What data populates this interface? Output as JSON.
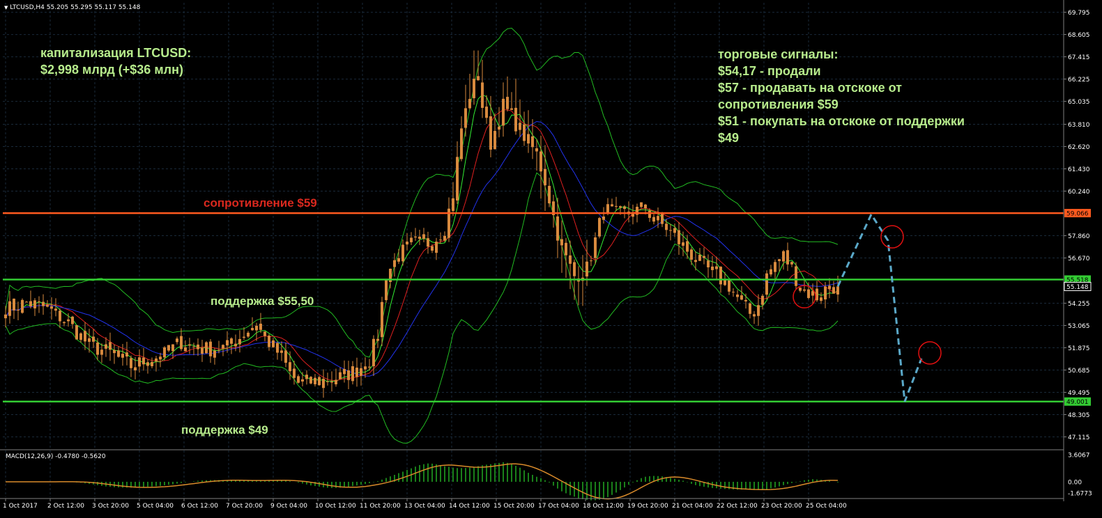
{
  "header": {
    "title": "LTCUSD,H4",
    "ohlc": "55.205 55.295 55.117 55.148"
  },
  "macd": {
    "label": "MACD(12,26,9) -0.4780 -0.5620",
    "ticks": [
      "3.6067",
      "0.00",
      "-1.6773"
    ]
  },
  "notes": {
    "cap_line1": "капитализация LTCUSD:",
    "cap_line2": "$2,998 млрд (+$36 млн)",
    "signals": [
      "торговые сигналы:",
      "$54,17 - продали",
      "$57 - продавать на отскоке от",
      "сопротивления $59",
      "$51 - покупать на отскоке от поддержки",
      "$49"
    ],
    "resistance_label": "сопротивление $59",
    "support1_label": "поддержка $55,50",
    "support2_label": "поддержка $49"
  },
  "colors": {
    "background": "#000000",
    "grid": "#1a2a3a",
    "axis": "#7f7f7f",
    "bull_candle": "#d88a3e",
    "bear_candle": "#d88a3e",
    "resistance": "#ff5a1f",
    "support": "#33cc33",
    "bollinger": "#22bb22",
    "ma_fast": "#33ee33",
    "ma_mid": "#e02020",
    "ma_slow": "#2233ee",
    "forecast": "#5aa8c8",
    "circle": "#e01010",
    "macd_hist": "#22aa22",
    "macd_signal": "#d98a2a",
    "text_note": "#b7ec8c",
    "text_red": "#d9281e"
  },
  "chart_data": {
    "type": "candlestick",
    "timeframe": "H4",
    "ylim": [
      46.5,
      70.3
    ],
    "y_ticks": [
      "69.795",
      "68.605",
      "67.415",
      "66.225",
      "65.035",
      "63.810",
      "62.620",
      "61.430",
      "60.240",
      "59.066",
      "57.860",
      "56.670",
      "55.518",
      "55.148",
      "54.255",
      "53.065",
      "51.875",
      "50.685",
      "49.495",
      "49.001",
      "48.305",
      "47.115"
    ],
    "x_ticks": [
      "1 Oct 2017",
      "2 Oct 12:00",
      "3 Oct 20:00",
      "5 Oct 04:00",
      "6 Oct 12:00",
      "7 Oct 20:00",
      "9 Oct 04:00",
      "10 Oct 12:00",
      "11 Oct 20:00",
      "13 Oct 04:00",
      "14 Oct 12:00",
      "15 Oct 20:00",
      "17 Oct 04:00",
      "18 Oct 12:00",
      "19 Oct 20:00",
      "21 Oct 04:00",
      "22 Oct 12:00",
      "23 Oct 20:00",
      "25 Oct 04:00"
    ],
    "levels": [
      {
        "name": "resistance",
        "value": 59.066,
        "tag": "59.066"
      },
      {
        "name": "support",
        "value": 55.518,
        "tag": "55.518"
      },
      {
        "name": "support",
        "value": 49.001,
        "tag": "49.001"
      }
    ],
    "current_price": {
      "value": 55.148,
      "tag": "55.148"
    },
    "price_anchors": [
      [
        0,
        53.9
      ],
      [
        5,
        54.3
      ],
      [
        10,
        54.0
      ],
      [
        15,
        53.2
      ],
      [
        20,
        52.0
      ],
      [
        25,
        51.6
      ],
      [
        30,
        50.9
      ],
      [
        35,
        51.3
      ],
      [
        38,
        51.5
      ],
      [
        42,
        52.2
      ],
      [
        45,
        51.9
      ],
      [
        48,
        51.8
      ],
      [
        53,
        51.9
      ],
      [
        57,
        52.6
      ],
      [
        60,
        53.2
      ],
      [
        62,
        52.4
      ],
      [
        66,
        51.4
      ],
      [
        68,
        50.5
      ],
      [
        70,
        50.0
      ],
      [
        75,
        50.1
      ],
      [
        80,
        50.3
      ],
      [
        84,
        50.7
      ],
      [
        87,
        51.2
      ],
      [
        89,
        52.6
      ],
      [
        91,
        55.8
      ],
      [
        94,
        56.8
      ],
      [
        97,
        57.4
      ],
      [
        102,
        57.5
      ],
      [
        105,
        58.3
      ],
      [
        107,
        60.1
      ],
      [
        109,
        63.6
      ],
      [
        111,
        65.4
      ],
      [
        113,
        66.4
      ],
      [
        114,
        64.8
      ],
      [
        116,
        62.8
      ],
      [
        119,
        64.8
      ],
      [
        121,
        64.2
      ],
      [
        124,
        63.2
      ],
      [
        127,
        62.2
      ],
      [
        129,
        60.8
      ],
      [
        131,
        58.9
      ],
      [
        133,
        57.1
      ],
      [
        136,
        55.7
      ],
      [
        139,
        56.1
      ],
      [
        141,
        57.6
      ],
      [
        143,
        59.3
      ],
      [
        146,
        59.0
      ],
      [
        150,
        59.1
      ],
      [
        153,
        59.4
      ],
      [
        155,
        58.7
      ],
      [
        158,
        58.3
      ],
      [
        162,
        57.3
      ],
      [
        166,
        56.4
      ],
      [
        170,
        55.7
      ],
      [
        173,
        55.2
      ],
      [
        176,
        54.2
      ],
      [
        178,
        53.7
      ],
      [
        180,
        54.2
      ],
      [
        182,
        55.7
      ],
      [
        184,
        56.4
      ],
      [
        186,
        56.8
      ],
      [
        188,
        56.1
      ],
      [
        190,
        55.1
      ],
      [
        192,
        54.8
      ],
      [
        194,
        54.6
      ],
      [
        196,
        55.0
      ],
      [
        198,
        55.148
      ]
    ],
    "forecast_path": [
      [
        55.148,
        0
      ],
      [
        59.0,
        8
      ],
      [
        57.6,
        12
      ],
      [
        49.001,
        16
      ],
      [
        51.3,
        20
      ]
    ],
    "signal_circles": [
      57.8,
      54.6,
      51.6
    ]
  }
}
